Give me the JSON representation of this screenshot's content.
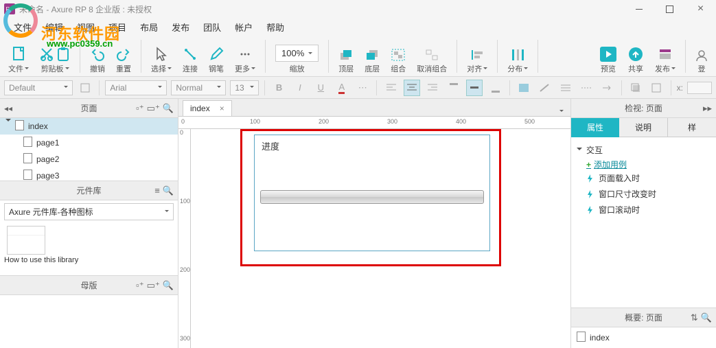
{
  "title": "未命名 - Axure RP 8 企业版 : 未授权",
  "app_badge": "RP",
  "watermark": {
    "brand": "河东软件园",
    "url": "www.pc0359.cn"
  },
  "menus": [
    "文件",
    "编辑",
    "视图",
    "项目",
    "布局",
    "发布",
    "团队",
    "帐户",
    "帮助"
  ],
  "toolbar": {
    "file": "文件",
    "clipboard": "剪贴板",
    "undo": "撤销",
    "redo": "重置",
    "select": "选择",
    "connect": "连接",
    "pen": "钢笔",
    "more": "更多",
    "zoom_value": "100%",
    "zoom_label": "缩放",
    "front": "顶层",
    "back": "底层",
    "group": "组合",
    "ungroup": "取消组合",
    "align": "对齐",
    "distribute": "分布",
    "preview": "预览",
    "share": "共享",
    "publish": "发布",
    "login": "登"
  },
  "format": {
    "style": "Default",
    "font": "Arial",
    "weight": "Normal",
    "size": "13",
    "x_label": "x:"
  },
  "left": {
    "pages_title": "页面",
    "tree": [
      {
        "label": "index",
        "children": [
          {
            "label": "page1"
          },
          {
            "label": "page2"
          },
          {
            "label": "page3"
          }
        ]
      }
    ],
    "library_title": "元件库",
    "library_select": "Axure 元件库-各种图标",
    "library_item": "How to use this library",
    "masters_title": "母版"
  },
  "canvas": {
    "tab": "index",
    "ruler_h": [
      "0",
      "100",
      "200",
      "300",
      "400",
      "500"
    ],
    "ruler_v": [
      "0",
      "100",
      "200",
      "300"
    ],
    "widget_title": "进度"
  },
  "right": {
    "inspect_title": "检视: 页面",
    "tabs": [
      "属性",
      "说明",
      "样"
    ],
    "section": "交互",
    "add_case": "添加用例",
    "events": [
      "页面载入时",
      "窗口尺寸改变时",
      "窗口滚动时"
    ],
    "outline_title": "概要: 页面",
    "outline_item": "index"
  }
}
